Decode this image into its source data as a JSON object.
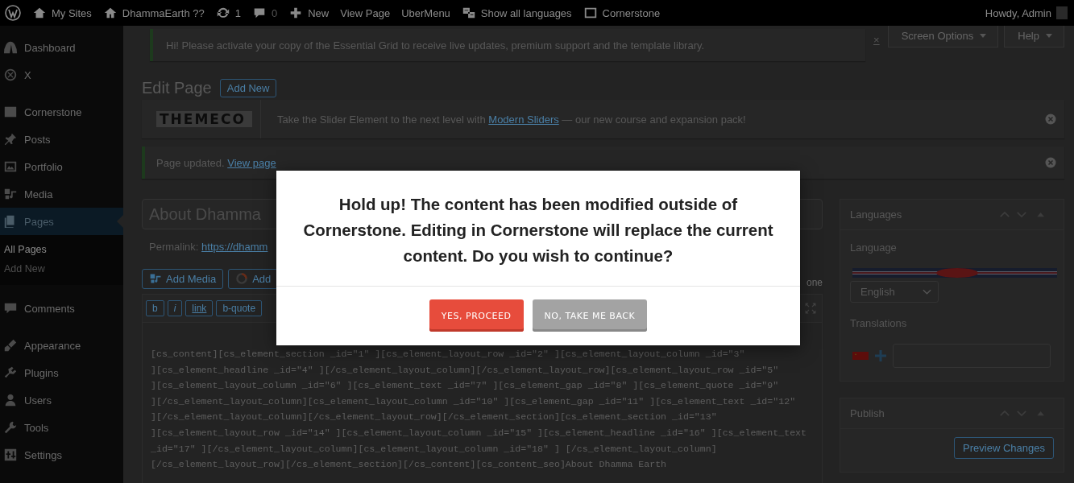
{
  "admin_bar": {
    "items": [
      {
        "kind": "sites",
        "label": "My Sites"
      },
      {
        "kind": "home",
        "label": "DhammaEarth ??"
      },
      {
        "kind": "updates",
        "label": "1"
      },
      {
        "kind": "comments",
        "label": "0"
      },
      {
        "kind": "new",
        "label": "New"
      },
      {
        "kind": "text",
        "label": "View Page"
      },
      {
        "kind": "text",
        "label": "UberMenu"
      },
      {
        "kind": "translate",
        "label": "Show all languages"
      },
      {
        "kind": "cornerstone",
        "label": "Cornerstone"
      }
    ],
    "greeting": "Howdy, Admin"
  },
  "sidebar": {
    "items": [
      {
        "kind": "dashboard",
        "label": "Dashboard",
        "selected": false
      },
      {
        "kind": "x",
        "label": "X",
        "selected": false
      },
      {
        "kind": "cornerstone",
        "label": "Cornerstone",
        "selected": false
      },
      {
        "kind": "posts",
        "label": "Posts",
        "selected": false
      },
      {
        "kind": "portfolio",
        "label": "Portfolio",
        "selected": false
      },
      {
        "kind": "media",
        "label": "Media",
        "selected": false
      },
      {
        "kind": "pages",
        "label": "Pages",
        "selected": true,
        "children": [
          {
            "label": "All Pages",
            "selected": true
          },
          {
            "label": "Add New",
            "selected": false
          }
        ]
      },
      {
        "kind": "comments",
        "label": "Comments",
        "selected": false
      },
      {
        "kind": "appearance",
        "label": "Appearance",
        "selected": false
      },
      {
        "kind": "plugins",
        "label": "Plugins",
        "selected": false
      },
      {
        "kind": "users",
        "label": "Users",
        "selected": false
      },
      {
        "kind": "tools",
        "label": "Tools",
        "selected": false
      },
      {
        "kind": "settings",
        "label": "Settings",
        "selected": false
      }
    ]
  },
  "screen_meta": [
    "Screen Options",
    "Help"
  ],
  "grid_notice": {
    "text": "Hi! Please activate your copy of the Essential Grid to receive live updates, premium support and the template library.",
    "dismiss": "×"
  },
  "heading": {
    "title": "Edit Page",
    "add_new": "Add New"
  },
  "themeco_notice": {
    "logo": "THEMECO",
    "before": "Take the Slider Element to the next level with",
    "link": "Modern Sliders",
    "after": "— our new course and expansion pack!"
  },
  "updated_notice": {
    "text": "Page updated.",
    "link": "View page"
  },
  "title_field": {
    "value": "About Dhamma"
  },
  "permalink": {
    "label": "Permalink:",
    "link": "https://dhamm"
  },
  "media_buttons": [
    "Add Media",
    "Add"
  ],
  "editor": {
    "tab": "one",
    "quicktags": [
      "b",
      "i",
      "link",
      "b-quote"
    ],
    "lines": [
      "[cs_content][cs_element_section _id=\"1\" ][cs_element_layout_row _id=\"2\" ][cs_element_layout_column _id=\"3\"",
      "][cs_element_headline _id=\"4\" ][/cs_element_layout_column][/cs_element_layout_row][cs_element_layout_row _id=\"5\"",
      "][cs_element_layout_column _id=\"6\" ][cs_element_text _id=\"7\" ][cs_element_gap _id=\"8\" ][cs_element_quote _id=\"9\"",
      "][/cs_element_layout_column][cs_element_layout_column _id=\"10\" ][cs_element_gap _id=\"11\" ][cs_element_text _id=\"12\"",
      "][/cs_element_layout_column][/cs_element_layout_row][/cs_element_section][cs_element_section _id=\"13\"",
      "][cs_element_layout_row _id=\"14\" ][cs_element_layout_column _id=\"15\" ][cs_element_headline _id=\"16\" ][cs_element_text",
      "_id=\"17\" ][/cs_element_layout_column][cs_element_layout_column _id=\"18\" ] [/cs_element_layout_column]",
      "[/cs_element_layout_row][/cs_element_section][/cs_content][cs_content_seo]About Dhamma Earth"
    ]
  },
  "languages_box": {
    "title": "Languages",
    "language_label": "Language",
    "language": "English",
    "translations_label": "Translations"
  },
  "publish_box": {
    "title": "Publish",
    "preview": "Preview Changes"
  },
  "modal": {
    "message": "Hold up! The content has been modified outside of Cornerstone. Editing in Cornerstone will replace the current content. Do you wish to continue?",
    "buttons": [
      {
        "kind": "confirm",
        "label": "YES, PROCEED"
      },
      {
        "kind": "cancel",
        "label": "NO, TAKE ME BACK"
      }
    ]
  }
}
